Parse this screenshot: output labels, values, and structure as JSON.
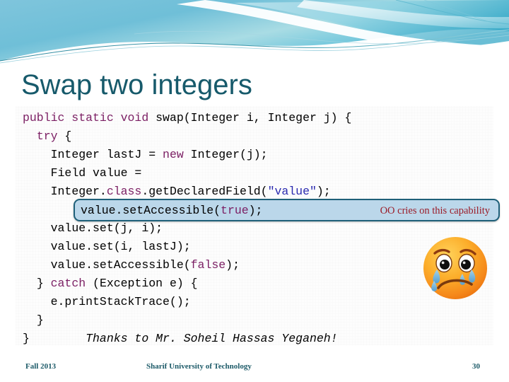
{
  "slide": {
    "title": "Swap two integers",
    "title_color": "#175A6B",
    "accent_color": "#1F6079",
    "keyword_color": "#7B1E63",
    "string_color": "#2A2AB0",
    "callout_fill": "#BBD7EA",
    "note_color": "#9B1C28"
  },
  "code": {
    "lines": [
      {
        "indent": 0,
        "tokens": [
          {
            "t": "public static void ",
            "k": "kw"
          },
          {
            "t": "swap(Integer i, Integer j) {",
            "k": "plain"
          }
        ]
      },
      {
        "indent": 1,
        "tokens": [
          {
            "t": "try",
            "k": "kw"
          },
          {
            "t": " {",
            "k": "plain"
          }
        ]
      },
      {
        "indent": 2,
        "tokens": [
          {
            "t": "Integer lastJ = ",
            "k": "plain"
          },
          {
            "t": "new",
            "k": "kw"
          },
          {
            "t": " Integer(j);",
            "k": "plain"
          }
        ]
      },
      {
        "indent": 2,
        "tokens": [
          {
            "t": "Field value =",
            "k": "plain"
          }
        ]
      },
      {
        "indent": 2,
        "tokens": [
          {
            "t": "Integer.",
            "k": "plain"
          },
          {
            "t": "class",
            "k": "kw"
          },
          {
            "t": ".getDeclaredField(",
            "k": "plain"
          },
          {
            "t": "\"value\"",
            "k": "str"
          },
          {
            "t": ");",
            "k": "plain"
          }
        ]
      },
      {
        "indent": 2,
        "tokens": [
          {
            "t": "",
            "k": "plain"
          }
        ]
      },
      {
        "indent": 2,
        "tokens": [
          {
            "t": "value.set(j, i);",
            "k": "plain"
          }
        ]
      },
      {
        "indent": 2,
        "tokens": [
          {
            "t": "value.set(i, lastJ);",
            "k": "plain"
          }
        ]
      },
      {
        "indent": 2,
        "tokens": [
          {
            "t": "value.setAccessible(",
            "k": "plain"
          },
          {
            "t": "false",
            "k": "kw"
          },
          {
            "t": ");",
            "k": "plain"
          }
        ]
      },
      {
        "indent": 1,
        "tokens": [
          {
            "t": "} ",
            "k": "plain"
          },
          {
            "t": "catch",
            "k": "kw"
          },
          {
            "t": " (Exception e) {",
            "k": "plain"
          }
        ]
      },
      {
        "indent": 2,
        "tokens": [
          {
            "t": "e.printStackTrace();",
            "k": "plain"
          }
        ]
      },
      {
        "indent": 1,
        "tokens": [
          {
            "t": "}",
            "k": "plain"
          }
        ]
      },
      {
        "indent": 0,
        "tokens": [
          {
            "t": "}",
            "k": "plain"
          },
          {
            "t": "        Thanks to Mr. Soheil Hassas Yeganeh!",
            "k": "thanks"
          }
        ]
      }
    ]
  },
  "callout": {
    "code_line": "value.setAccessible(true);",
    "code_prefix": "value.setAccessible(",
    "code_keyword": "true",
    "code_suffix": ");",
    "note": "OO cries on this capability"
  },
  "emoji": {
    "name": "crying-face",
    "face_color_light": "#FFC43D",
    "face_color_dark": "#F07C14",
    "tear_color": "#6FB4E8"
  },
  "footer": {
    "left": "Fall 2013",
    "center": "Sharif University of Technology",
    "page": "30"
  }
}
